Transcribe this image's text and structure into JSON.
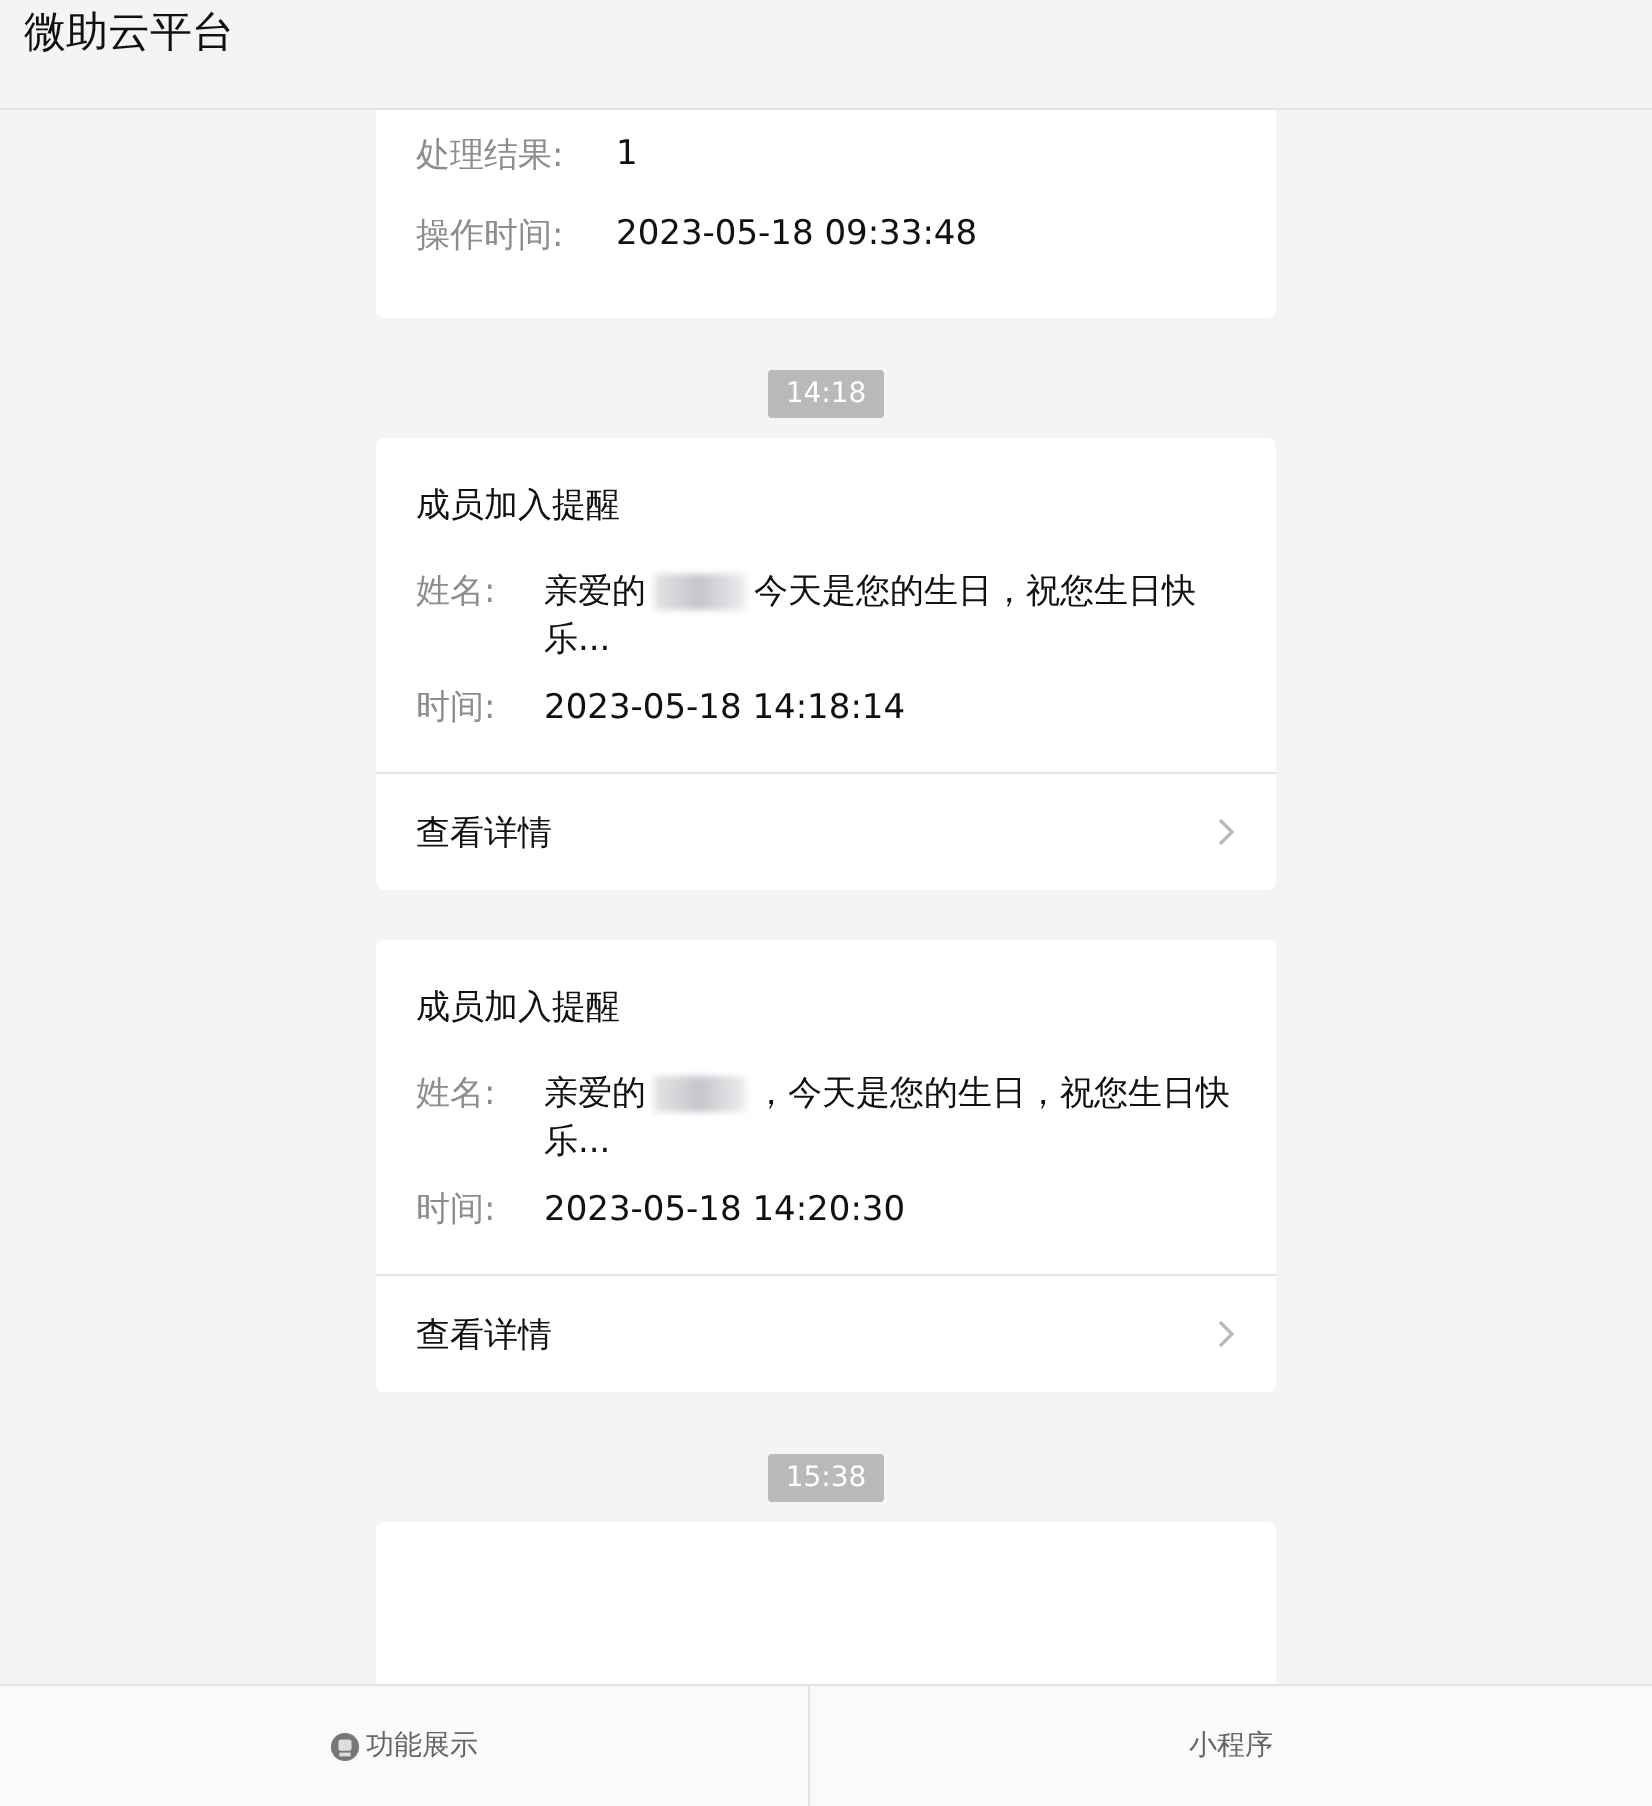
{
  "header": {
    "title": "微助云平台"
  },
  "feed": [
    {
      "kind": "record",
      "rows": [
        {
          "label": "处理结果:",
          "value": "1"
        },
        {
          "label": "操作时间:",
          "value": "2023-05-18 09:33:48"
        }
      ]
    },
    {
      "kind": "time",
      "text": "14:18"
    },
    {
      "kind": "notice",
      "title": "成员加入提醒",
      "name_label": "姓名:",
      "name_prefix": "亲爱的",
      "name_suffix": "今天是您的生日，祝您生日快乐...",
      "time_label": "时间:",
      "time_value": "2023-05-18 14:18:14",
      "link": "查看详情"
    },
    {
      "kind": "notice",
      "title": "成员加入提醒",
      "name_label": "姓名:",
      "name_prefix": "亲爱的",
      "name_suffix": "，今天是您的生日，祝您生日快乐...",
      "time_label": "时间:",
      "time_value": "2023-05-18 14:20:30",
      "link": "查看详情"
    },
    {
      "kind": "time",
      "text": "15:38"
    },
    {
      "kind": "empty"
    }
  ],
  "footer": [
    {
      "label": "功能展示",
      "icon": true
    },
    {
      "label": "小程序",
      "icon": false
    }
  ]
}
